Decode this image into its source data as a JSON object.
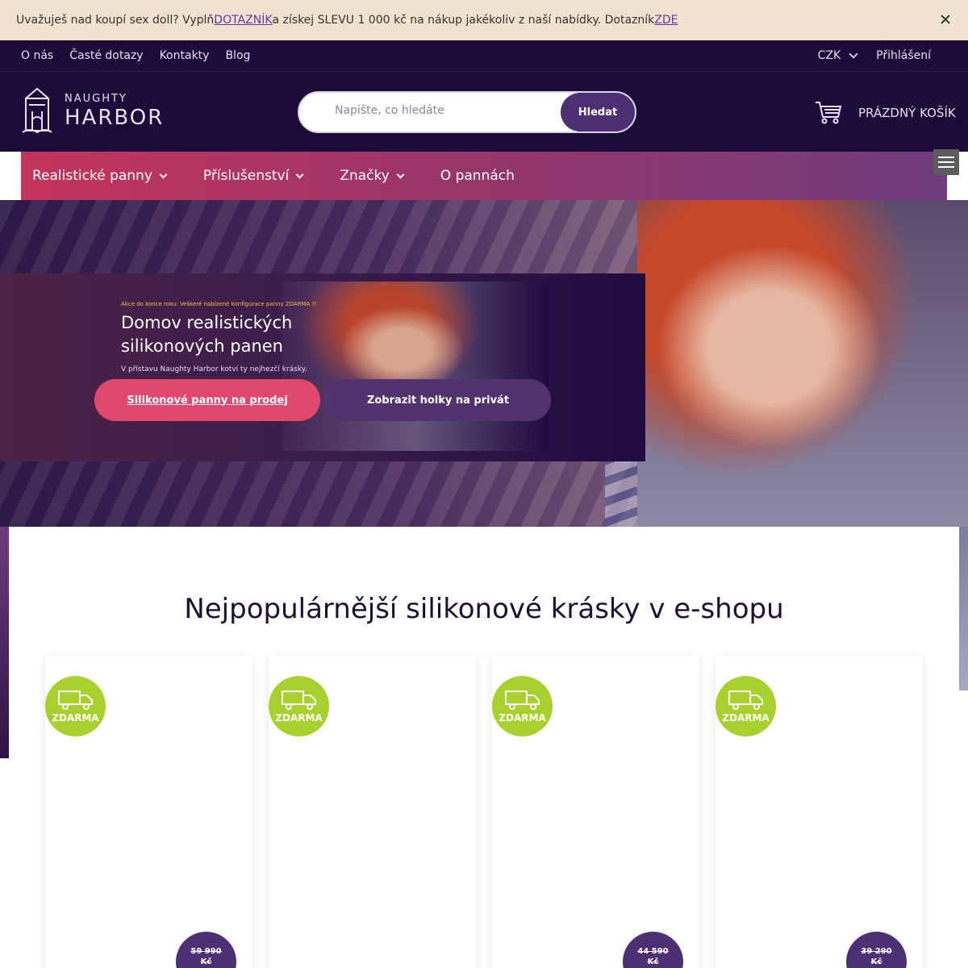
{
  "promo": {
    "text_before": "Uvažuješ nad koupí sex doll? Vyplň ",
    "link1": "DOTAZNÍK",
    "text_middle": " a získej SLEVU 1 000 kč na nákup jakékoliv z naší nabídky. Dotazník ",
    "link2": "ZDE"
  },
  "toplinks": {
    "items": [
      "O nás",
      "Časté dotazy",
      "Kontakty",
      "Blog"
    ],
    "currency": "CZK",
    "login": "Přihlášení"
  },
  "header": {
    "logo_top": "NAUGHTY",
    "logo_bottom": "HARBOR",
    "search_placeholder": "Napište, co hledáte",
    "search_button": "Hledat",
    "cart_label": "PRÁZDNÝ KOŠÍK"
  },
  "nav": {
    "items": [
      "Realistické panny",
      "Příslušenství",
      "Značky",
      "O pannách"
    ]
  },
  "hero": {
    "promo_small": "Akce do konce roku: Veškeré nabízené konfigurace panny ZDARMA !!",
    "title": "Domov realistických silikonových panen",
    "subtitle": "V přístavu Naughty Harbor kotví ty nejhezčí krásky.",
    "button_primary": "Silikonové panny na prodej",
    "button_secondary": "Zobrazit holky na privát"
  },
  "main": {
    "heading": "Nejpopulárnější silikonové krásky v e-shopu",
    "products": [
      {
        "badge": "ZDARMA",
        "price_old": "59 990",
        "currency": "Kč"
      },
      {
        "badge": "ZDARMA",
        "price_old": "",
        "currency": ""
      },
      {
        "badge": "ZDARMA",
        "price_old": "44 590",
        "currency": "Kč"
      },
      {
        "badge": "ZDARMA",
        "price_old": "39 290",
        "currency": "Kč"
      }
    ]
  },
  "colors": {
    "dark_navy": "#1c0a38",
    "accent_pink": "#e0496f",
    "accent_purple": "#4d2f73",
    "badge_green": "#a9d12e",
    "promo_bg": "#efe3cf"
  },
  "icons": {
    "close": "close-icon",
    "cart": "cart-icon",
    "truck": "truck-icon",
    "menu": "hamburger-icon",
    "logo": "lighthouse-logo-icon"
  }
}
